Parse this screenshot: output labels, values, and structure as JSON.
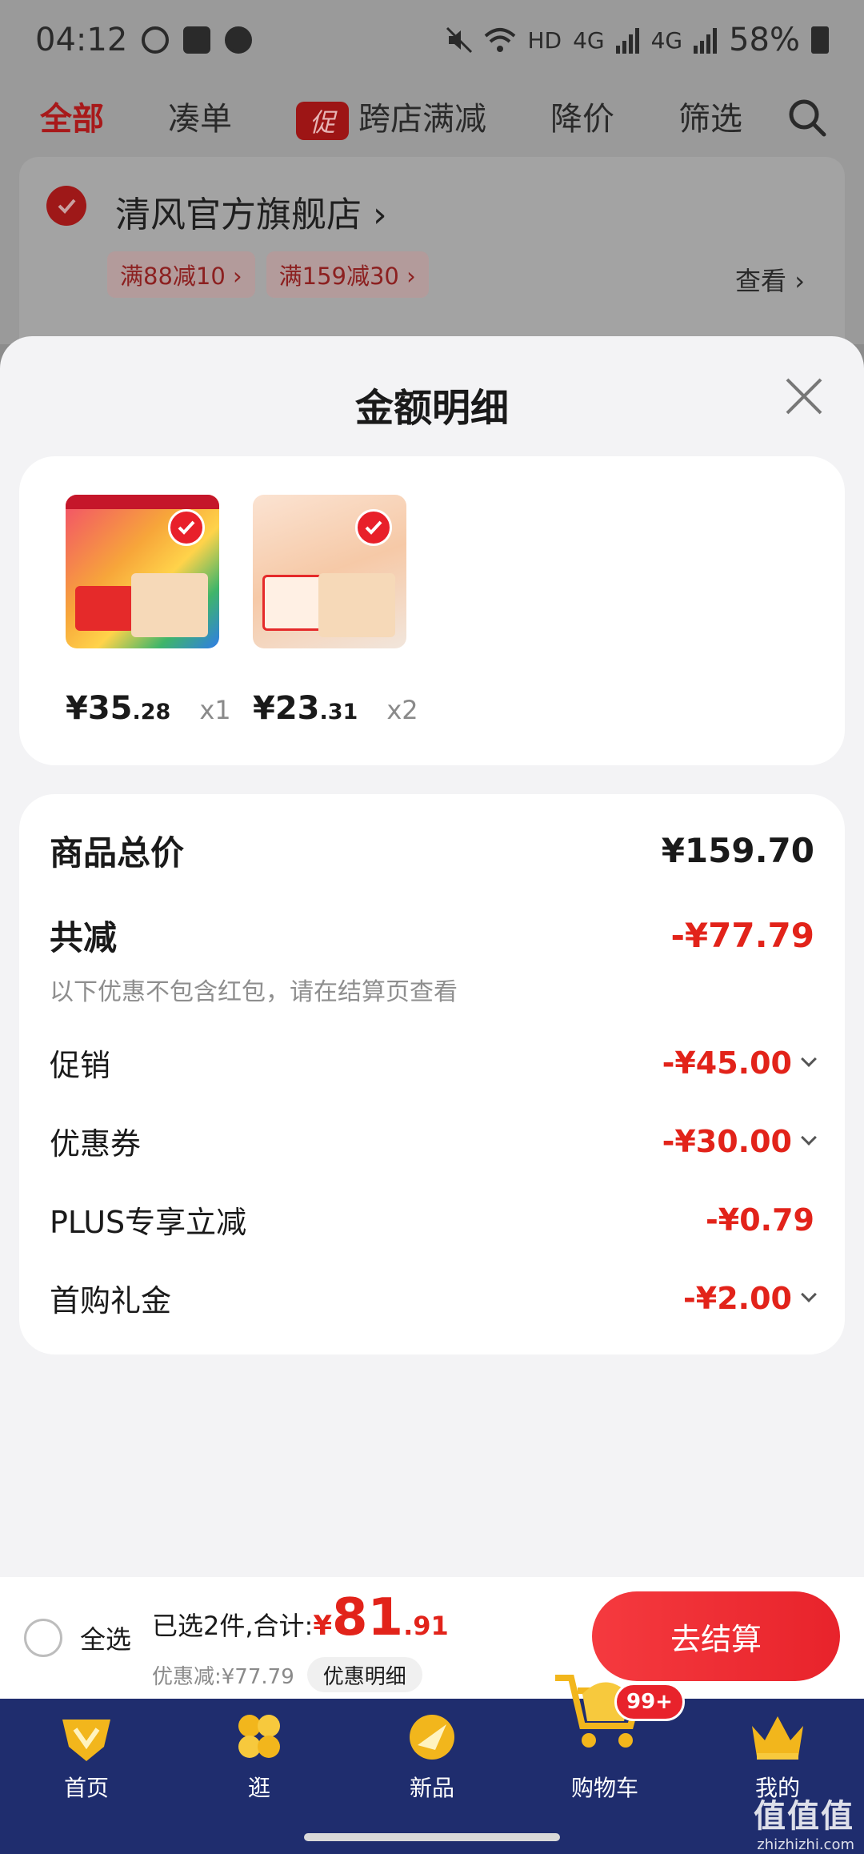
{
  "status_bar": {
    "time": "04:12",
    "network": "HD",
    "net_4g_1": "4G",
    "net_4g_2": "4G",
    "battery": "58%"
  },
  "top_nav": {
    "items": [
      "全部",
      "凑单",
      "跨店满减",
      "降价",
      "筛选"
    ],
    "promo_tag": "促"
  },
  "store": {
    "name": "清风官方旗舰店 ›",
    "chips": [
      "满88减10 ›",
      "满159减30 ›"
    ],
    "view_link": "查看 ›"
  },
  "sheet": {
    "title": "金额明细",
    "products": [
      {
        "price_int": "¥35",
        "price_frac": ".28",
        "qty": "x1"
      },
      {
        "price_int": "¥23",
        "price_frac": ".31",
        "qty": "x2"
      }
    ],
    "total": {
      "label": "商品总价",
      "value": "¥159.70"
    },
    "reduction": {
      "label": "共减",
      "value": "-¥77.79",
      "note": "以下优惠不包含红包，请在结算页查看"
    },
    "lines": [
      {
        "label": "促销",
        "value": "-¥45.00"
      },
      {
        "label": "优惠券",
        "value": "-¥30.00"
      },
      {
        "label": "PLUS专享立减",
        "value": "-¥0.79"
      },
      {
        "label": "首购礼金",
        "value": "-¥2.00"
      }
    ]
  },
  "checkout": {
    "select_all": "全选",
    "selected_text": "已选2件,合计:",
    "yen": "¥",
    "total_int": "81",
    "total_frac": ".91",
    "discount_text": "优惠减:¥77.79",
    "detail_button": "优惠明细",
    "checkout_button": "去结算"
  },
  "tabbar": {
    "items": [
      "首页",
      "逛",
      "新品",
      "购物车",
      "我的"
    ],
    "cart_badge": "99+"
  },
  "watermark": {
    "main": "值值值",
    "sub": "zhizhizhi.com"
  },
  "colors": {
    "accent_red": "#e2231a",
    "tabbar_bg": "#1f2d6e",
    "sheet_bg": "#f3f3f5"
  }
}
